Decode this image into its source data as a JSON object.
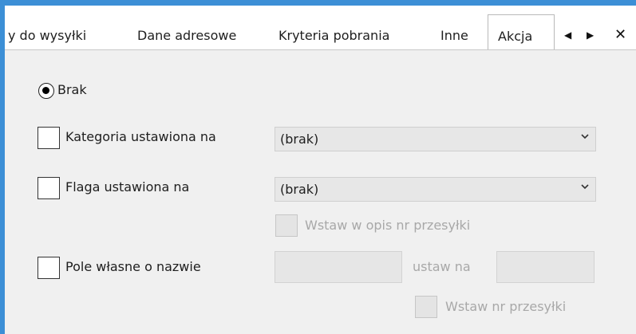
{
  "tabs": [
    {
      "label": "y do wysyłki"
    },
    {
      "label": "Dane adresowe"
    },
    {
      "label": "Kryteria pobrania"
    },
    {
      "label": "Inne"
    },
    {
      "label": "Akcja"
    }
  ],
  "active_tab": "Akcja",
  "nav": {
    "prev_icon": "caret-left-icon",
    "next_icon": "caret-right-icon",
    "close_icon": "close-icon",
    "close_glyph": "✕"
  },
  "options": {
    "none_label": "Brak",
    "category_label": "Kategoria ustawiona na",
    "category_value": "(brak)",
    "flag_label": "Flaga ustawiona na",
    "flag_value": "(brak)",
    "insert_desc_label": "Wstaw w opis nr przesyłki",
    "custom_field_label": "Pole własne o nazwie",
    "set_to_label": "ustaw na",
    "insert_nr_label": "Wstaw nr przesyłki"
  },
  "colors": {
    "accent": "#3c8fd6",
    "panel": "#f0f0f0"
  }
}
